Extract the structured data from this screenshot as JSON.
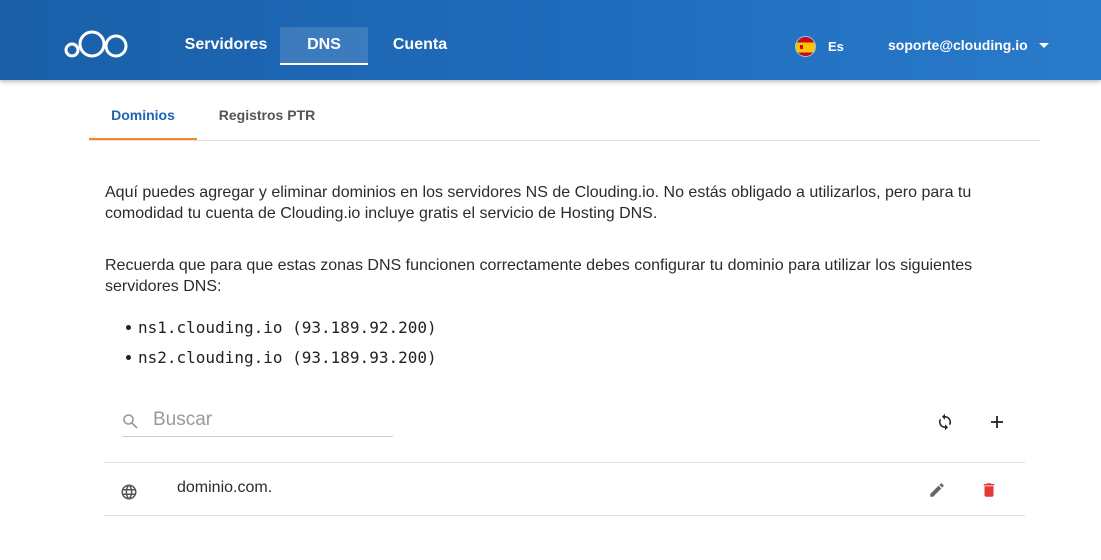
{
  "nav": {
    "items": [
      {
        "label": "Servidores"
      },
      {
        "label": "DNS",
        "active": true
      },
      {
        "label": "Cuenta"
      }
    ],
    "language": "Es",
    "user_email": "soporte@clouding.io"
  },
  "tabs": [
    {
      "label": "Dominios",
      "active": true
    },
    {
      "label": "Registros PTR"
    }
  ],
  "content": {
    "intro": "Aquí puedes agregar y eliminar dominios en los servidores NS de Clouding.io. No estás obligado a utilizarlos, pero para tu comodidad tu cuenta de Clouding.io incluye gratis el servicio de Hosting DNS.",
    "reminder": "Recuerda que para que estas zonas DNS funcionen correctamente debes configurar tu dominio para utilizar los siguientes servidores DNS:",
    "nameservers": [
      "ns1.clouding.io (93.189.92.200)",
      "ns2.clouding.io (93.189.93.200)"
    ]
  },
  "search": {
    "placeholder": "Buscar",
    "value": ""
  },
  "domains": [
    {
      "name": "dominio.com."
    }
  ],
  "colors": {
    "header": "#1f6bbb",
    "tab_active_text": "#1a66b5",
    "tab_indicator": "#f0892c",
    "delete": "#e53935"
  },
  "icons": {
    "logo": "clouding-logo",
    "flag": "spain-flag-icon",
    "search": "search-icon",
    "refresh": "refresh-icon",
    "add": "plus-icon",
    "globe": "globe-icon",
    "edit": "pencil-icon",
    "delete": "trash-icon"
  }
}
